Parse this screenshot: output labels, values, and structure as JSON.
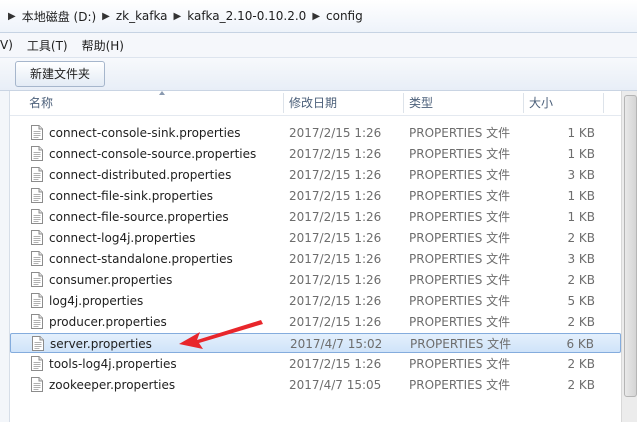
{
  "address": {
    "crumbs": [
      "本地磁盘 (D:)",
      "zk_kafka",
      "kafka_2.10-0.10.2.0",
      "config"
    ]
  },
  "menu": {
    "items": [
      "V)",
      "工具(T)",
      "帮助(H)"
    ]
  },
  "toolbar": {
    "new_folder_label": "新建文件夹"
  },
  "columns": {
    "name": "名称",
    "date": "修改日期",
    "type": "类型",
    "size": "大小"
  },
  "files": [
    {
      "name": "connect-console-sink.properties",
      "date": "2017/2/15 1:26",
      "type": "PROPERTIES 文件",
      "size": "1 KB",
      "selected": false
    },
    {
      "name": "connect-console-source.properties",
      "date": "2017/2/15 1:26",
      "type": "PROPERTIES 文件",
      "size": "1 KB",
      "selected": false
    },
    {
      "name": "connect-distributed.properties",
      "date": "2017/2/15 1:26",
      "type": "PROPERTIES 文件",
      "size": "3 KB",
      "selected": false
    },
    {
      "name": "connect-file-sink.properties",
      "date": "2017/2/15 1:26",
      "type": "PROPERTIES 文件",
      "size": "1 KB",
      "selected": false
    },
    {
      "name": "connect-file-source.properties",
      "date": "2017/2/15 1:26",
      "type": "PROPERTIES 文件",
      "size": "1 KB",
      "selected": false
    },
    {
      "name": "connect-log4j.properties",
      "date": "2017/2/15 1:26",
      "type": "PROPERTIES 文件",
      "size": "2 KB",
      "selected": false
    },
    {
      "name": "connect-standalone.properties",
      "date": "2017/2/15 1:26",
      "type": "PROPERTIES 文件",
      "size": "3 KB",
      "selected": false
    },
    {
      "name": "consumer.properties",
      "date": "2017/2/15 1:26",
      "type": "PROPERTIES 文件",
      "size": "2 KB",
      "selected": false
    },
    {
      "name": "log4j.properties",
      "date": "2017/2/15 1:26",
      "type": "PROPERTIES 文件",
      "size": "5 KB",
      "selected": false
    },
    {
      "name": "producer.properties",
      "date": "2017/2/15 1:26",
      "type": "PROPERTIES 文件",
      "size": "2 KB",
      "selected": false
    },
    {
      "name": "server.properties",
      "date": "2017/4/7 15:02",
      "type": "PROPERTIES 文件",
      "size": "6 KB",
      "selected": true
    },
    {
      "name": "tools-log4j.properties",
      "date": "2017/2/15 1:26",
      "type": "PROPERTIES 文件",
      "size": "2 KB",
      "selected": false
    },
    {
      "name": "zookeeper.properties",
      "date": "2017/4/7 15:05",
      "type": "PROPERTIES 文件",
      "size": "2 KB",
      "selected": false
    }
  ],
  "colors": {
    "selection_border": "#84acdd",
    "annotation_arrow": "#e8262b"
  }
}
